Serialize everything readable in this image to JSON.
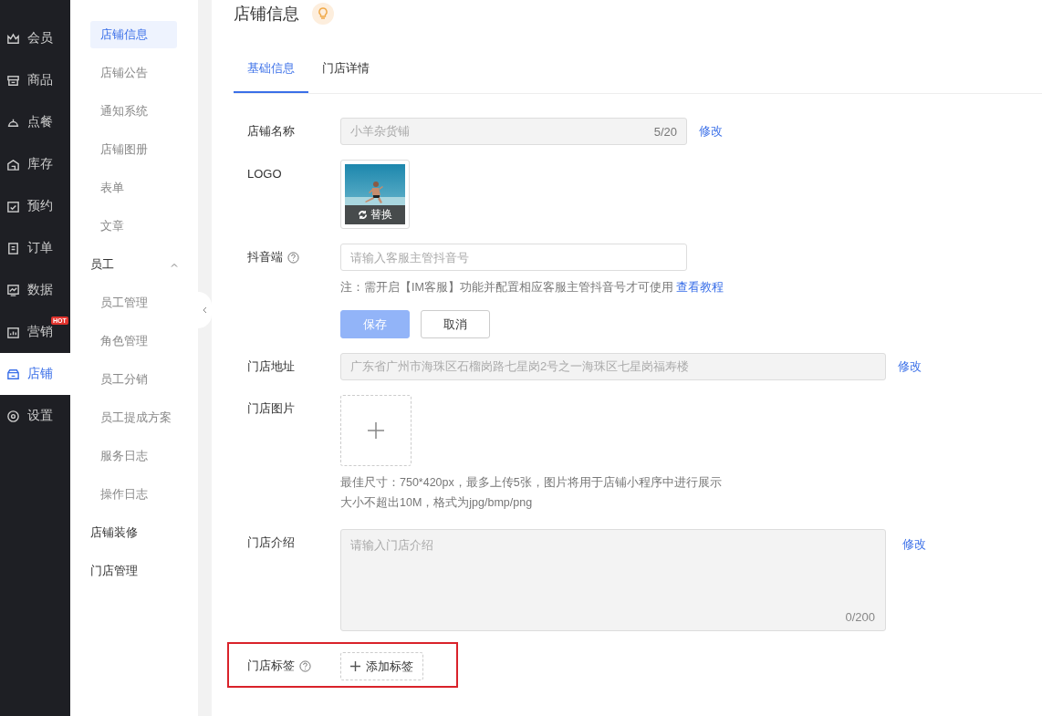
{
  "nav_rail": {
    "items": [
      {
        "label": "会员",
        "selected": false
      },
      {
        "label": "商品",
        "selected": false
      },
      {
        "label": "点餐",
        "selected": false
      },
      {
        "label": "库存",
        "selected": false
      },
      {
        "label": "预约",
        "selected": false
      },
      {
        "label": "订单",
        "selected": false
      },
      {
        "label": "数据",
        "selected": false
      },
      {
        "label": "营销",
        "selected": false,
        "badge": "HOT"
      },
      {
        "label": "店铺",
        "selected": true
      },
      {
        "label": "设置",
        "selected": false
      }
    ]
  },
  "sub_nav": {
    "items": [
      {
        "label": "店铺信息",
        "selected": true
      },
      {
        "label": "店铺公告",
        "selected": false
      },
      {
        "label": "通知系统",
        "selected": false
      },
      {
        "label": "店铺图册",
        "selected": false
      },
      {
        "label": "表单",
        "selected": false
      },
      {
        "label": "文章",
        "selected": false
      },
      {
        "label": "员工",
        "kind": "group",
        "expanded": true,
        "children": [
          {
            "label": "员工管理",
            "selected": false
          },
          {
            "label": "角色管理",
            "selected": false
          },
          {
            "label": "员工分销",
            "selected": false
          },
          {
            "label": "员工提成方案",
            "selected": false
          },
          {
            "label": "服务日志",
            "selected": false
          },
          {
            "label": "操作日志",
            "selected": false
          }
        ]
      },
      {
        "label": "店铺装修",
        "kind": "header"
      },
      {
        "label": "门店管理",
        "kind": "header"
      }
    ]
  },
  "page": {
    "title": "店铺信息",
    "tabs": [
      {
        "label": "基础信息",
        "selected": true
      },
      {
        "label": "门店详情",
        "selected": false
      }
    ],
    "form": [
      {
        "kind": "text",
        "label": "店铺名称",
        "value": "小羊杂货铺",
        "counter": "5/20",
        "action": "修改",
        "disabled": true
      },
      {
        "label": "LOGO",
        "button": "替换"
      },
      {
        "kind": "input",
        "label": "抖音端",
        "help": true,
        "placeholder": "请输入客服主管抖音号",
        "note": "注：需开启【IM客服】功能并配置相应客服主管抖音号才可使用",
        "note_link": "查看教程",
        "buttons": [
          {
            "label": "保存",
            "kind": "primary",
            "disabled": true
          },
          {
            "label": "取消",
            "kind": "default"
          }
        ]
      },
      {
        "kind": "text",
        "label": "门店地址",
        "value": "广东省广州市海珠区石榴岗路七星岗2号之一海珠区七星岗福寿楼",
        "action": "修改",
        "disabled": true,
        "wide": true
      },
      {
        "kind": "upload",
        "label": "门店图片",
        "hints": [
          "最佳尺寸：750*420px，最多上传5张，图片将用于店铺小程序中进行展示",
          "大小不超出10M，格式为jpg/bmp/png"
        ]
      },
      {
        "kind": "textarea",
        "label": "门店介绍",
        "placeholder": "请输入门店介绍",
        "counter": "0/200",
        "action": "修改"
      },
      {
        "kind": "tags",
        "label": "门店标签",
        "help": true,
        "button": "添加标签",
        "highlighted": true
      }
    ]
  }
}
